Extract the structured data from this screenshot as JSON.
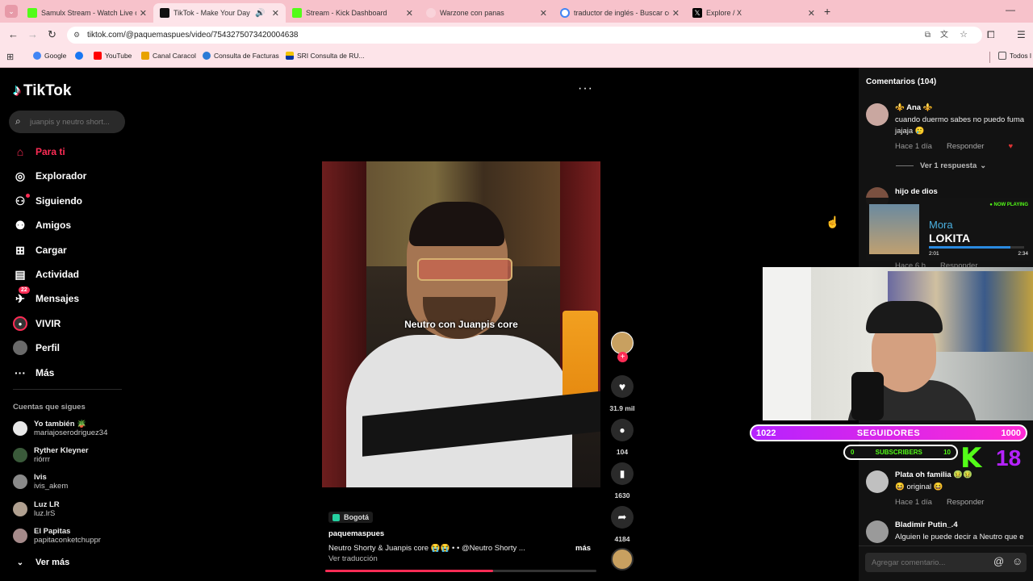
{
  "tabs": [
    {
      "title": "Samulx Stream - Watch Live on",
      "close": "✕",
      "color": "#53fc18"
    },
    {
      "title": "TikTok - Make Your Day",
      "close": "✕",
      "color": "#111111"
    },
    {
      "title": "Stream - Kick Dashboard",
      "close": "✕",
      "color": "#53fc18"
    },
    {
      "title": "Warzone con panas",
      "close": "✕",
      "color": "#f4a7b4"
    },
    {
      "title": "traductor de inglés - Buscar co",
      "close": "✕",
      "color": "#4285f4"
    },
    {
      "title": "Explore / X",
      "close": "✕",
      "color": "#000000"
    }
  ],
  "new_tab": "+",
  "url": "tiktok.com/@paquemaspues/video/7543275073420004638",
  "bookmarks": [
    {
      "label": "Google",
      "color": "#4285f4"
    },
    {
      "label": "YouTube",
      "color": "#ff0000"
    },
    {
      "label": "Canal Caracol",
      "color": "#e8a200"
    },
    {
      "label": "Consulta de Facturas",
      "color": "#2b7bd6"
    },
    {
      "label": "SRI Consulta de RU...",
      "color": "#f2c200"
    }
  ],
  "bookmarks_all": "Todos l",
  "tiktok": {
    "logo": "TikTok",
    "search_placeholder": "juanpis y neutro short...",
    "nav": [
      {
        "label": "Para ti",
        "icon": "home-icon",
        "active": true
      },
      {
        "label": "Explorador",
        "icon": "compass-icon"
      },
      {
        "label": "Siguiendo",
        "icon": "user-follow-icon"
      },
      {
        "label": "Amigos",
        "icon": "friends-icon"
      },
      {
        "label": "Cargar",
        "icon": "upload-icon"
      },
      {
        "label": "Actividad",
        "icon": "activity-icon"
      },
      {
        "label": "Mensajes",
        "icon": "messages-icon",
        "badge": "22"
      },
      {
        "label": "VIVIR",
        "icon": "live-icon"
      },
      {
        "label": "Perfil",
        "icon": "profile-icon"
      },
      {
        "label": "Más",
        "icon": "more-icon"
      }
    ],
    "following_title": "Cuentas que sigues",
    "following": [
      {
        "name": "Yo también 🪴",
        "handle": "mariajoserodriguez34"
      },
      {
        "name": "Ryther Kleyner",
        "handle": "riórrr"
      },
      {
        "name": "Ivis",
        "handle": "ivis_akem"
      },
      {
        "name": "Luz LR",
        "handle": "luz.lrS"
      },
      {
        "name": "El Papitas",
        "handle": "papitaconketchuppr"
      }
    ],
    "see_more": "Ver más"
  },
  "video": {
    "caption_overlay": "Neutro con Juanpis core",
    "location": "Bogotá",
    "author": "paquemaspues",
    "description": "Neutro Shorty & Juanpis core 😭😭 • • @Neutro Shorty ...",
    "more": "más",
    "translate": "Ver traducción",
    "likes": "31.9 mil",
    "comments": "104",
    "saves": "1630",
    "shares": "4184",
    "progress": 0.62
  },
  "comments_panel": {
    "title": "Comentarios (104)",
    "items": [
      {
        "user": "⚜️ Ana ⚜️",
        "text1": "cuando duermo sabes no puedo fuma",
        "text2": "jajaja 🥲",
        "time": "Hace 1 día",
        "reply": "Responder",
        "avatar": "#c9a7a0"
      },
      {
        "user": "hijo de dios",
        "text1": "",
        "text2": "",
        "time": "Hace 6 h",
        "reply": "Responder",
        "avatar": "#7a5040"
      },
      {
        "user": "Plata oh familia 🤢🤢",
        "text1": "😆 original 😆",
        "text2": "",
        "time": "Hace 1 día",
        "reply": "Responder",
        "avatar": "#bbbbbb"
      },
      {
        "user": "Bladimir Putin_.4",
        "text1": "Alguien le puede decir a Neutro que e",
        "text2": "",
        "time": "",
        "reply": "",
        "avatar": "#999999"
      }
    ],
    "view_replies": "Ver 1 respuesta",
    "add_placeholder": "Agregar comentario..."
  },
  "now_playing": {
    "tag": "NOW PLAYING",
    "artist": "Mora",
    "song": "LOKITA",
    "elapsed": "2:01",
    "total": "2:34",
    "progress": 0.86
  },
  "overlay": {
    "followers_left": "1022",
    "followers_label": "SEGUIDORES",
    "followers_right": "1000",
    "subs_left": "0",
    "subs_label": "SUBSCRIBERS",
    "subs_right": "10",
    "kick_number": "18"
  }
}
